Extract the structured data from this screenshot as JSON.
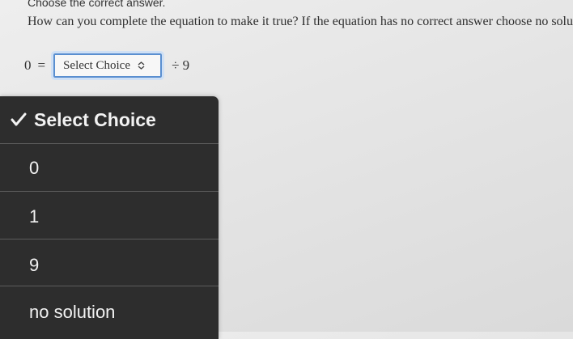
{
  "instruction": "Choose the correct answer.",
  "question": "How can you complete the equation to make it true? If the equation has no correct answer choose no solution",
  "equation": {
    "lhs": "0",
    "equals": "=",
    "select_value": "Select Choice",
    "rhs": "÷ 9"
  },
  "dropdown": {
    "selected_label": "Select Choice",
    "options": [
      "0",
      "1",
      "9",
      "no solution"
    ]
  },
  "colors": {
    "accent": "#5a8fd0",
    "menu_bg": "#2d2d2d",
    "menu_text": "#f2f2f2"
  }
}
